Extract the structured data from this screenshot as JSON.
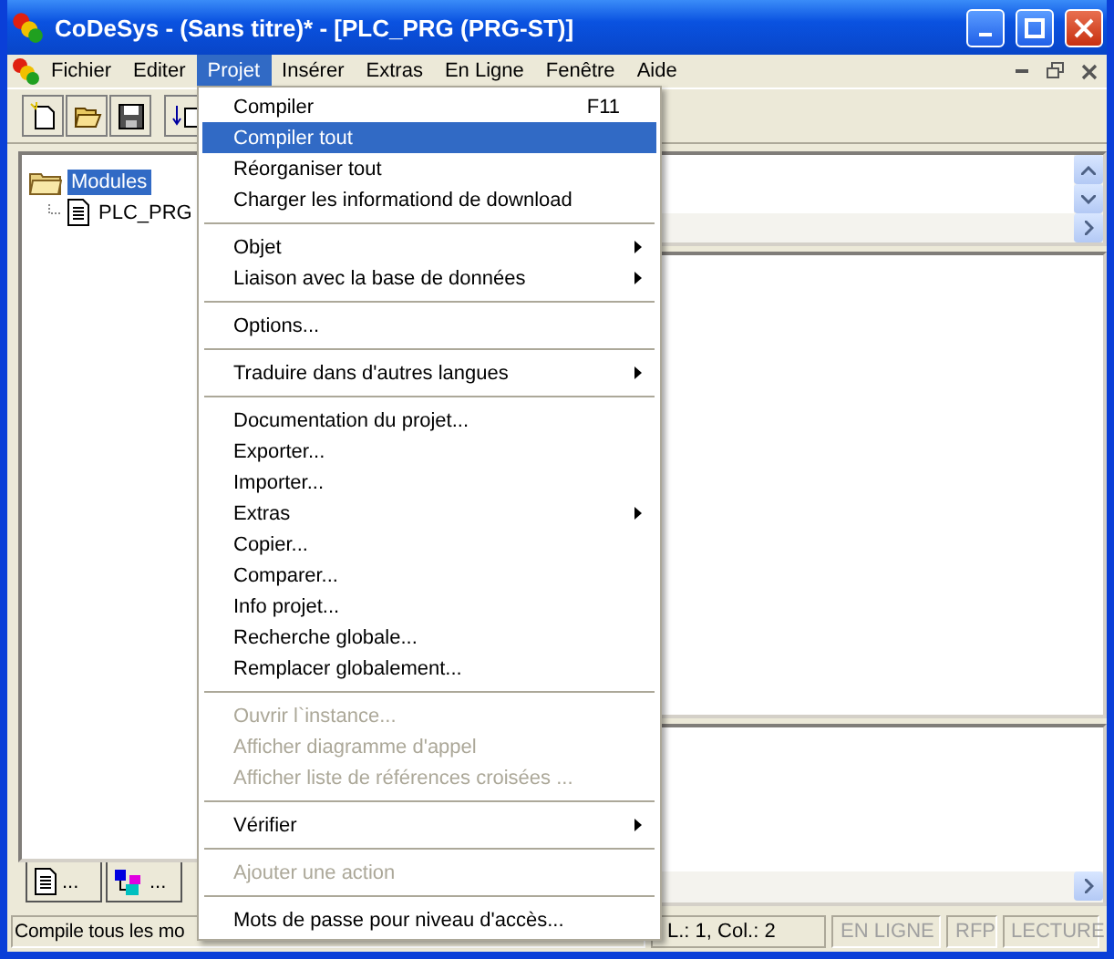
{
  "window": {
    "title": "CoDeSys - (Sans titre)* - [PLC_PRG (PRG-ST)]"
  },
  "menubar": [
    {
      "label": "Fichier",
      "selected": false
    },
    {
      "label": "Editer",
      "selected": false
    },
    {
      "label": "Projet",
      "selected": true
    },
    {
      "label": "Insérer",
      "selected": false
    },
    {
      "label": "Extras",
      "selected": false
    },
    {
      "label": "En Ligne",
      "selected": false
    },
    {
      "label": "Fenêtre",
      "selected": false
    },
    {
      "label": "Aide",
      "selected": false
    }
  ],
  "tree": [
    {
      "label": "Modules",
      "selected": true,
      "kind": "folder",
      "children": [
        {
          "label": "PLC_PRG",
          "selected": false,
          "kind": "page"
        }
      ]
    }
  ],
  "object_tabs": [
    {
      "label": "...",
      "kind": "page"
    },
    {
      "label": "...",
      "kind": "blocks"
    }
  ],
  "menu": [
    {
      "kind": "item",
      "label": "Compiler",
      "shortcut": "F11",
      "submenu": false,
      "disabled": false,
      "selected": false
    },
    {
      "kind": "item",
      "label": "Compiler tout",
      "submenu": false,
      "disabled": false,
      "selected": true
    },
    {
      "kind": "item",
      "label": "Réorganiser tout",
      "submenu": false,
      "disabled": false,
      "selected": false
    },
    {
      "kind": "item",
      "label": "Charger les informationd de download",
      "submenu": false,
      "disabled": false,
      "selected": false
    },
    {
      "kind": "separator"
    },
    {
      "kind": "item",
      "label": "Objet",
      "submenu": true,
      "disabled": false,
      "selected": false
    },
    {
      "kind": "item",
      "label": "Liaison avec la base de données",
      "submenu": true,
      "disabled": false,
      "selected": false
    },
    {
      "kind": "separator"
    },
    {
      "kind": "item",
      "label": "Options...",
      "submenu": false,
      "disabled": false,
      "selected": false
    },
    {
      "kind": "separator"
    },
    {
      "kind": "item",
      "label": "Traduire dans d'autres langues",
      "submenu": true,
      "disabled": false,
      "selected": false
    },
    {
      "kind": "separator"
    },
    {
      "kind": "item",
      "label": "Documentation du projet...",
      "submenu": false,
      "disabled": false,
      "selected": false
    },
    {
      "kind": "item",
      "label": "Exporter...",
      "submenu": false,
      "disabled": false,
      "selected": false
    },
    {
      "kind": "item",
      "label": "Importer...",
      "submenu": false,
      "disabled": false,
      "selected": false
    },
    {
      "kind": "item",
      "label": "Extras",
      "submenu": true,
      "disabled": false,
      "selected": false
    },
    {
      "kind": "item",
      "label": "Copier...",
      "submenu": false,
      "disabled": false,
      "selected": false
    },
    {
      "kind": "item",
      "label": "Comparer...",
      "submenu": false,
      "disabled": false,
      "selected": false
    },
    {
      "kind": "item",
      "label": "Info projet...",
      "submenu": false,
      "disabled": false,
      "selected": false
    },
    {
      "kind": "item",
      "label": "Recherche globale...",
      "submenu": false,
      "disabled": false,
      "selected": false
    },
    {
      "kind": "item",
      "label": "Remplacer globalement...",
      "submenu": false,
      "disabled": false,
      "selected": false
    },
    {
      "kind": "separator"
    },
    {
      "kind": "item",
      "label": "Ouvrir l`instance...",
      "submenu": false,
      "disabled": true,
      "selected": false
    },
    {
      "kind": "item",
      "label": "Afficher diagramme d'appel",
      "submenu": false,
      "disabled": true,
      "selected": false
    },
    {
      "kind": "item",
      "label": "Afficher liste de références croisées ...",
      "submenu": false,
      "disabled": true,
      "selected": false
    },
    {
      "kind": "separator"
    },
    {
      "kind": "item",
      "label": "Vérifier",
      "submenu": true,
      "disabled": false,
      "selected": false
    },
    {
      "kind": "separator"
    },
    {
      "kind": "item",
      "label": "Ajouter une action",
      "submenu": false,
      "disabled": true,
      "selected": false
    },
    {
      "kind": "separator"
    },
    {
      "kind": "item",
      "label": "Mots de passe pour niveau d'accès...",
      "submenu": false,
      "disabled": false,
      "selected": false
    }
  ],
  "status_bar": {
    "message": "Compile tous les mo",
    "position": "L.: 1, Col.: 2",
    "indicators": [
      {
        "label": "EN LIGNE",
        "on": false
      },
      {
        "label": "RFP",
        "on": false
      },
      {
        "label": "LECTURE",
        "on": false
      }
    ]
  }
}
